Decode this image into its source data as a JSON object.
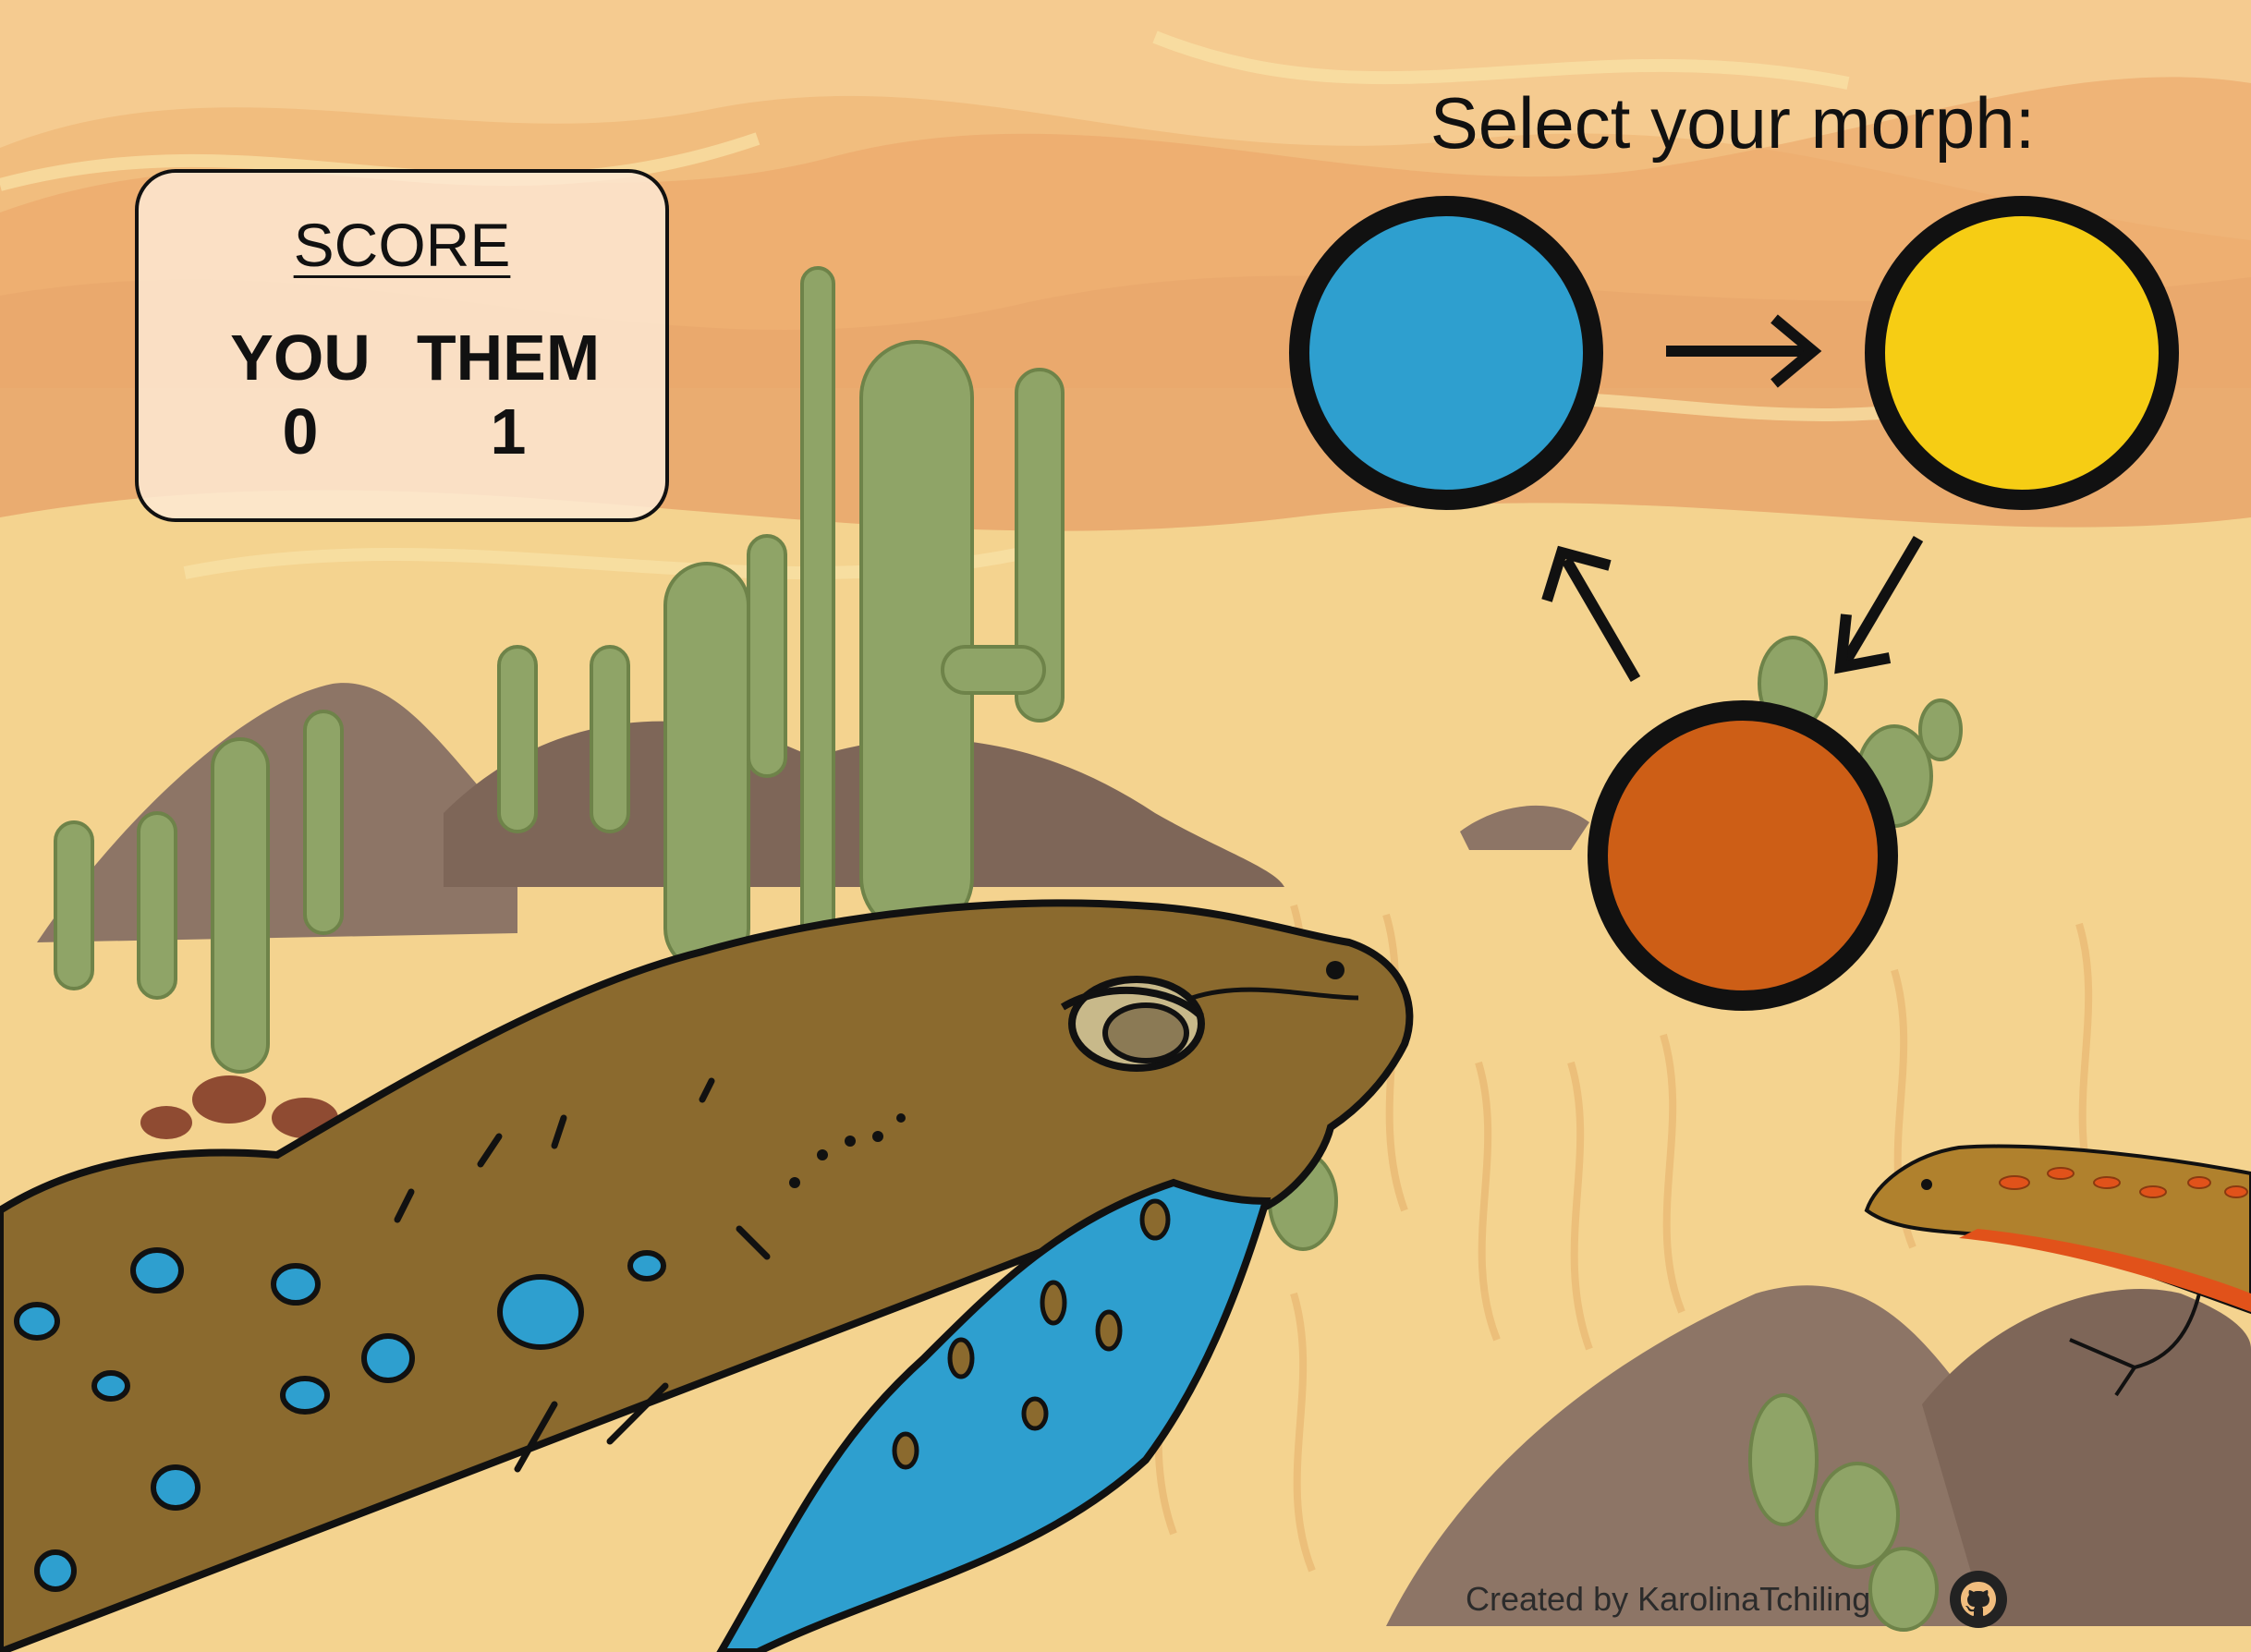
{
  "score": {
    "title": "SCORE",
    "you_label": "YOU",
    "them_label": "THEM",
    "you_value": "0",
    "them_value": "1"
  },
  "morph_picker": {
    "title": "Select your morph:",
    "options": [
      {
        "id": "blue",
        "color": "#2e9fcf"
      },
      {
        "id": "yellow",
        "color": "#f6cd14"
      },
      {
        "id": "orange",
        "color": "#cd5e16"
      }
    ],
    "cycle": [
      "blue beats yellow",
      "yellow beats orange",
      "orange beats blue"
    ]
  },
  "footer": {
    "credit": "Created by KarolinaTchiling",
    "github_icon": "github-icon"
  },
  "colors": {
    "sand": "#f4d38f",
    "sky": "#f1bd7e",
    "cactus": "#8fa467",
    "rock": "#8d7566",
    "player_lizard": "#8b6a2e",
    "player_throat": "#2e9fcf",
    "opponent_lizard": "#b0812d",
    "opponent_belly": "#e1521a"
  }
}
